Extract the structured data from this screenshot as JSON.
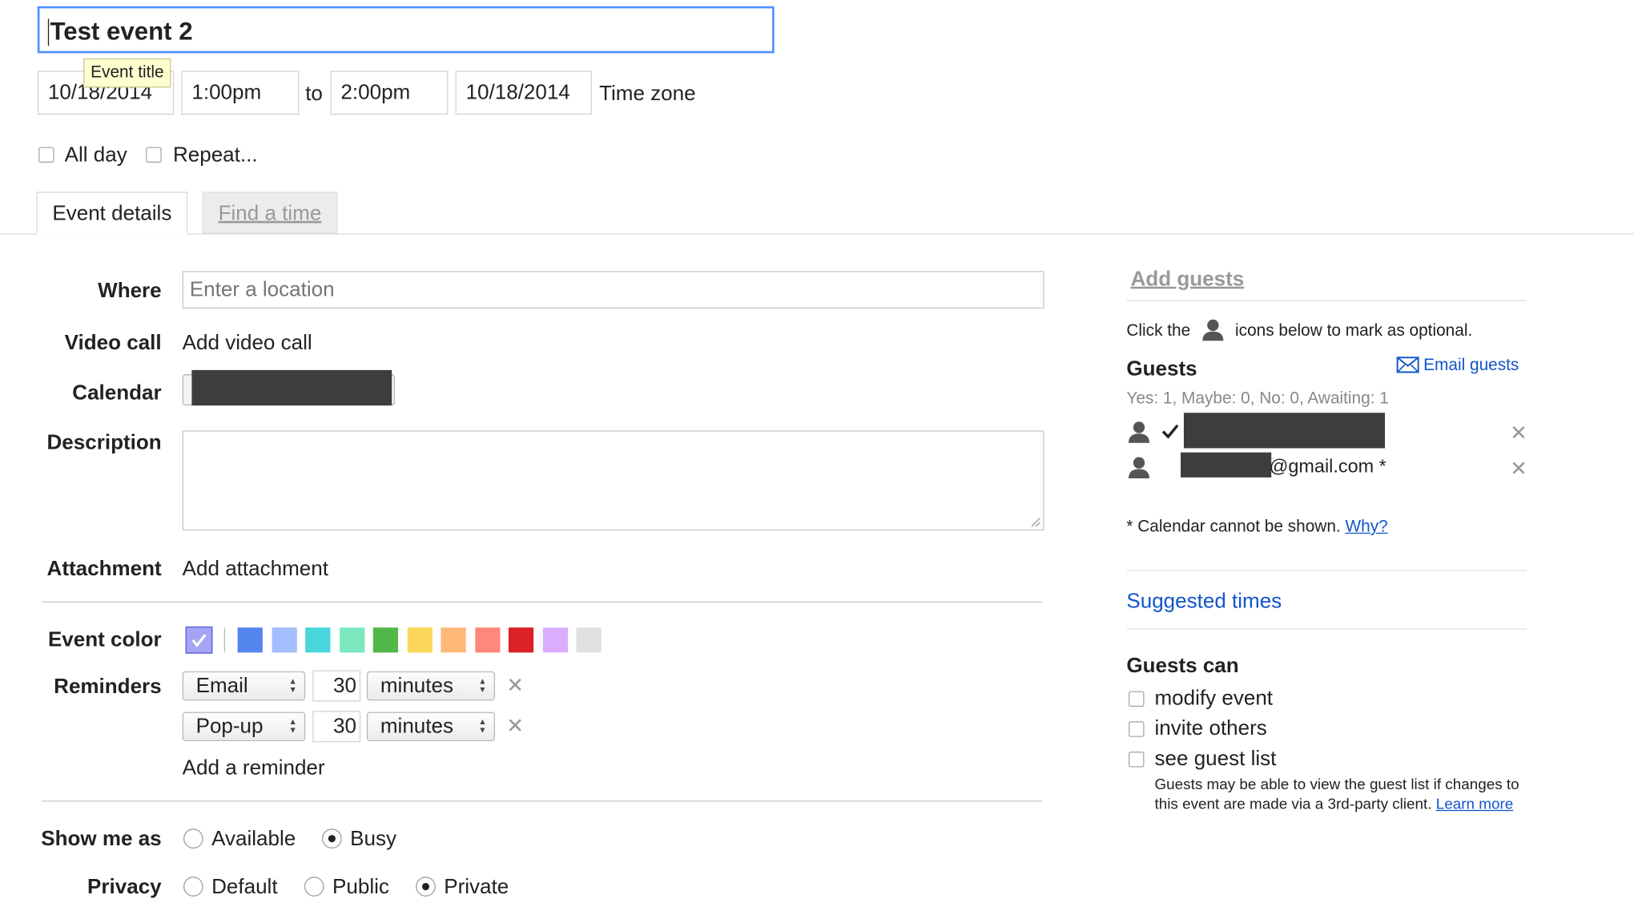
{
  "title": {
    "value": "Test event 2",
    "tooltip": "Event title"
  },
  "datetime": {
    "start_date": "10/18/2014",
    "start_time": "1:00pm",
    "to_label": "to",
    "end_time": "2:00pm",
    "end_date": "10/18/2014",
    "timezone_link": "Time zone"
  },
  "options": {
    "all_day": "All day",
    "repeat": "Repeat..."
  },
  "tabs": {
    "event_details": "Event details",
    "find_a_time": "Find a time"
  },
  "form": {
    "where_label": "Where",
    "where_placeholder": "Enter a location",
    "video_label": "Video call",
    "video_link": "Add video call",
    "calendar_label": "Calendar",
    "description_label": "Description",
    "attachment_label": "Attachment",
    "attachment_link": "Add attachment",
    "event_color_label": "Event color",
    "reminders_label": "Reminders",
    "add_reminder_link": "Add a reminder",
    "show_me_as_label": "Show me as",
    "privacy_label": "Privacy"
  },
  "event_colors": [
    "#5484ed",
    "#a4bdfc",
    "#46d6db",
    "#7ae7bf",
    "#51b749",
    "#fbd75b",
    "#ffb878",
    "#ff887c",
    "#dc2127",
    "#dbadff",
    "#e1e1e1"
  ],
  "reminders": [
    {
      "method": "Email",
      "amount": "30",
      "unit": "minutes"
    },
    {
      "method": "Pop-up",
      "amount": "30",
      "unit": "minutes"
    }
  ],
  "show_me_as": {
    "available": "Available",
    "busy": "Busy",
    "selected": "Busy"
  },
  "privacy": {
    "default": "Default",
    "public": "Public",
    "private": "Private",
    "selected": "Private"
  },
  "guests_panel": {
    "add_guests_link": "Add guests",
    "hint_before": "Click the",
    "hint_after": "icons below to mark as optional.",
    "guests_heading": "Guests",
    "email_guests_link": "Email guests",
    "rsvp_summary": "Yes: 1, Maybe: 0, No: 0, Awaiting: 1",
    "guest2_suffix": "@gmail.com *",
    "calendar_note": "* Calendar cannot be shown.",
    "why_link": "Why?",
    "suggested_times_link": "Suggested times",
    "guests_can_heading": "Guests can",
    "modify_event": "modify event",
    "invite_others": "invite others",
    "see_guest_list": "see guest list",
    "guest_list_note": "Guests may be able to view the guest list if changes to this event are made via a 3rd-party client.",
    "learn_more_link": "Learn more"
  },
  "accent_color": "#1155cc",
  "icons": [
    "person-icon",
    "checkmark-icon",
    "remove-icon",
    "envelope-icon",
    "select-arrows-icon",
    "resize-grip-icon"
  ]
}
